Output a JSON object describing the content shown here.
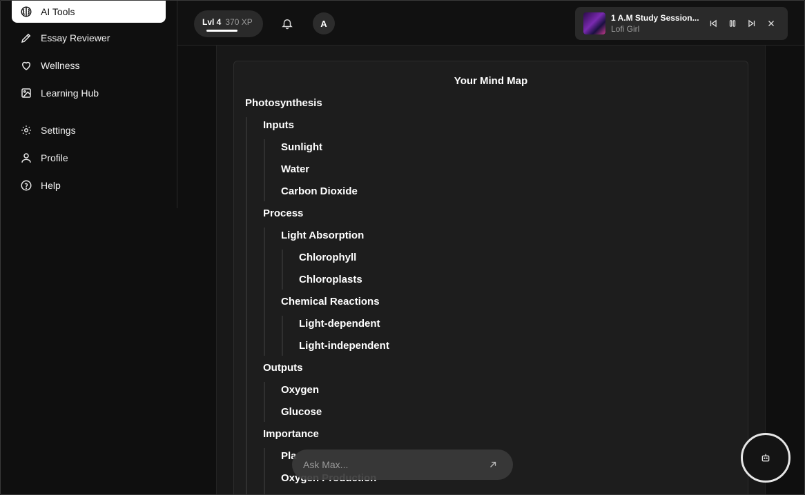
{
  "sidebar": {
    "items": [
      {
        "label": "AI Tools",
        "icon": "brain-icon",
        "active": true
      },
      {
        "label": "Essay Reviewer",
        "icon": "pencil-icon"
      },
      {
        "label": "Wellness",
        "icon": "heart-icon"
      },
      {
        "label": "Learning Hub",
        "icon": "image-icon"
      },
      {
        "label": "Settings",
        "icon": "gear-icon"
      },
      {
        "label": "Profile",
        "icon": "user-icon"
      },
      {
        "label": "Help",
        "icon": "help-circle-icon"
      }
    ]
  },
  "topbar": {
    "level": "Lvl 4",
    "xp": "370 XP",
    "xp_progress": 0.6,
    "avatar_initial": "A"
  },
  "player": {
    "title": "1 A.M Study Session...",
    "artist": "Lofi Girl"
  },
  "mindmap": {
    "title": "Your Mind Map",
    "nodes": [
      {
        "label": "Photosynthesis",
        "depth": 0
      },
      {
        "label": "Inputs",
        "depth": 1
      },
      {
        "label": "Sunlight",
        "depth": 2
      },
      {
        "label": "Water",
        "depth": 2
      },
      {
        "label": "Carbon Dioxide",
        "depth": 2
      },
      {
        "label": "Process",
        "depth": 1
      },
      {
        "label": "Light Absorption",
        "depth": 2
      },
      {
        "label": "Chlorophyll",
        "depth": 3
      },
      {
        "label": "Chloroplasts",
        "depth": 3
      },
      {
        "label": "Chemical Reactions",
        "depth": 2
      },
      {
        "label": "Light-dependent",
        "depth": 3
      },
      {
        "label": "Light-independent",
        "depth": 3
      },
      {
        "label": "Outputs",
        "depth": 1
      },
      {
        "label": "Oxygen",
        "depth": 2
      },
      {
        "label": "Glucose",
        "depth": 2
      },
      {
        "label": "Importance",
        "depth": 1
      },
      {
        "label": "Pla",
        "depth": 2
      },
      {
        "label": "Oxygen Production",
        "depth": 2
      }
    ]
  },
  "ask": {
    "placeholder": "Ask Max..."
  }
}
